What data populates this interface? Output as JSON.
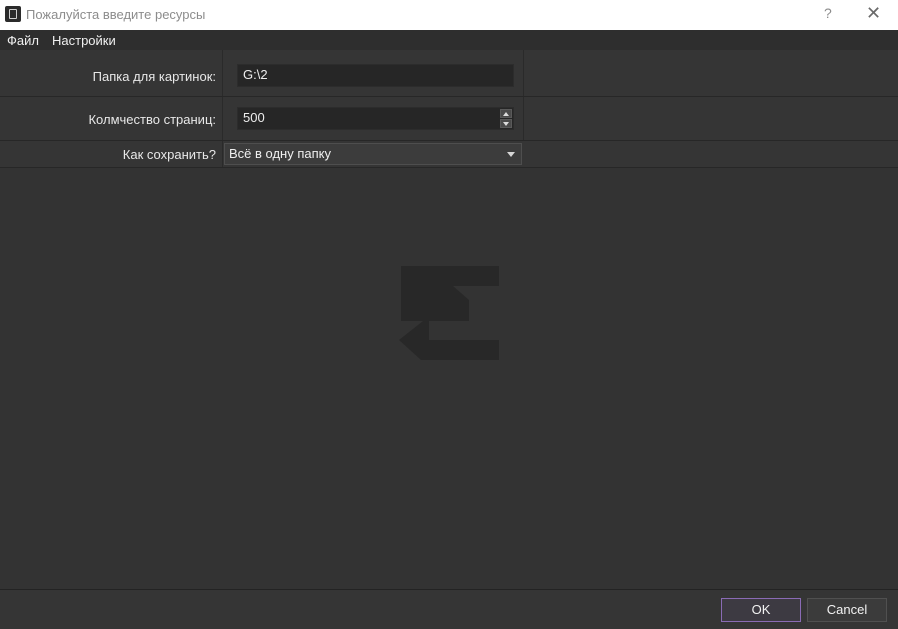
{
  "window": {
    "title": "Пожалуйста введите ресурсы",
    "help": "?",
    "close": "✕"
  },
  "menu": {
    "file": "Файл",
    "settings": "Настройки"
  },
  "form": {
    "folder": {
      "label": "Папка для картинок:",
      "value": "G:\\2"
    },
    "pages": {
      "label": "Колмчество страниц:",
      "value": "500"
    },
    "save": {
      "label": "Как сохранить?",
      "selected": "Всё в одну папку"
    }
  },
  "buttons": {
    "ok": "OK",
    "cancel": "Cancel"
  },
  "colors": {
    "background": "#333333",
    "accent": "#8a6bb5",
    "logo": "#282828"
  },
  "icons": {
    "app": "app-icon",
    "help": "help-icon",
    "close": "close-icon",
    "spin_up": "chevron-up-icon",
    "spin_down": "chevron-down-icon",
    "combo": "chevron-down-icon",
    "watermark": "logo-icon"
  }
}
